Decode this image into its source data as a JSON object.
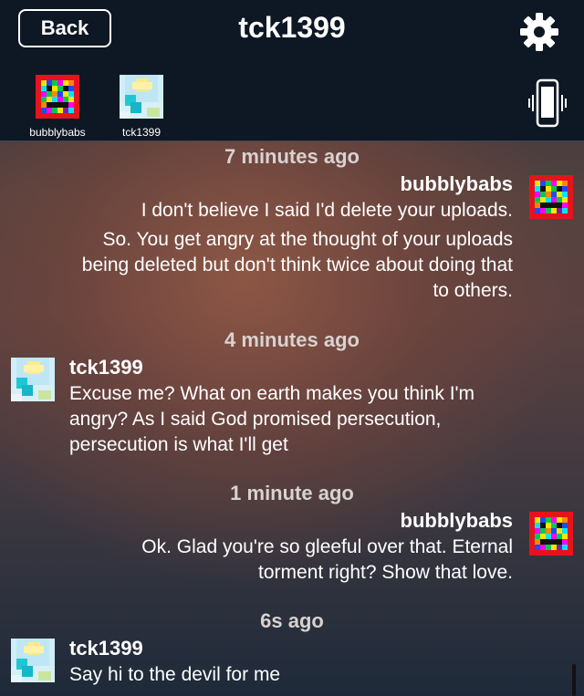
{
  "header": {
    "back_label": "Back",
    "title": "tck1399",
    "settings_icon": "gear-icon",
    "vibrate_icon": "phone-vibrate-icon"
  },
  "participants": [
    {
      "name": "bubblybabs",
      "avatar": "pixel-face-avatar"
    },
    {
      "name": "tck1399",
      "avatar": "pixel-sun-avatar"
    }
  ],
  "messages": {
    "t1": "7 minutes ago",
    "m1": {
      "sender": "bubblybabs",
      "lines": [
        "I don't believe I said I'd delete your uploads.",
        "So.  You get angry at the thought of your uploads",
        "being deleted but don't think twice about doing that",
        "to others."
      ]
    },
    "t2": "4 minutes ago",
    "m2": {
      "sender": "tck1399",
      "lines": [
        "Excuse me? What on earth makes you think I'm",
        "angry? As I said God promised persecution,",
        "persecution is what I'll get"
      ]
    },
    "t3": "1 minute ago",
    "m3": {
      "sender": "bubblybabs",
      "lines": [
        "Ok.  Glad you're so gleeful over that.  Eternal",
        "torment right?  Show that love."
      ]
    },
    "t4": "6s ago",
    "m4": {
      "sender": "tck1399",
      "lines": [
        "Say hi to the devil for me"
      ]
    }
  }
}
